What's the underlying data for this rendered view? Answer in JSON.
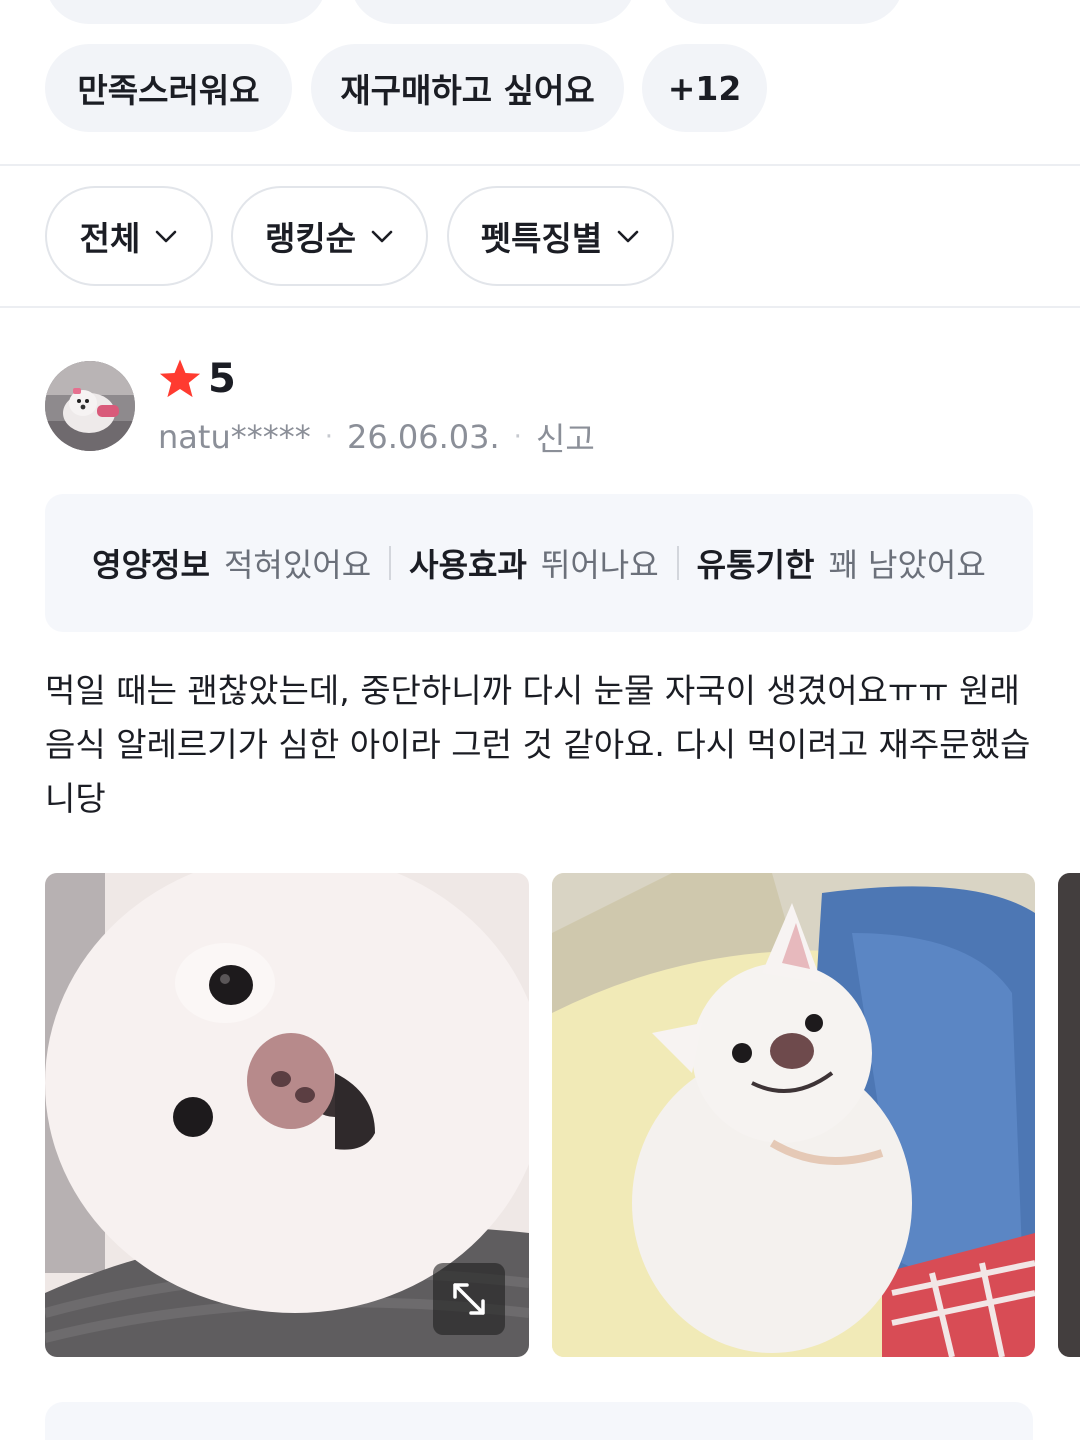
{
  "keywords": {
    "row2": [
      "만족스러워요",
      "재구매하고 싶어요"
    ],
    "more": "+12"
  },
  "filters": [
    "전체",
    "랭킹순",
    "펫특징별"
  ],
  "review": {
    "rating": "5",
    "user": "natu*****",
    "date": "26.06.03.",
    "report": "신고",
    "attributes": [
      {
        "key": "영양정보",
        "value": "적혀있어요"
      },
      {
        "key": "사용효과",
        "value": "뛰어나요"
      },
      {
        "key": "유통기한",
        "value": "꽤 남았어요"
      }
    ],
    "text": "먹일 때는 괜찮았는데, 중단하니까 다시 눈물 자국이 생겼어요ㅠㅠ 원래 음식 알레르기가 심한 아이라 그런 것 같아요. 다시 먹이려고 재주문했습니당"
  },
  "icons": {
    "star": "star-icon",
    "chevron": "chevron-down-icon",
    "expand": "expand-icon"
  },
  "colors": {
    "star": "#ff3b30",
    "chip_bg": "#f2f4f8",
    "muted_text": "#8b8f98"
  }
}
